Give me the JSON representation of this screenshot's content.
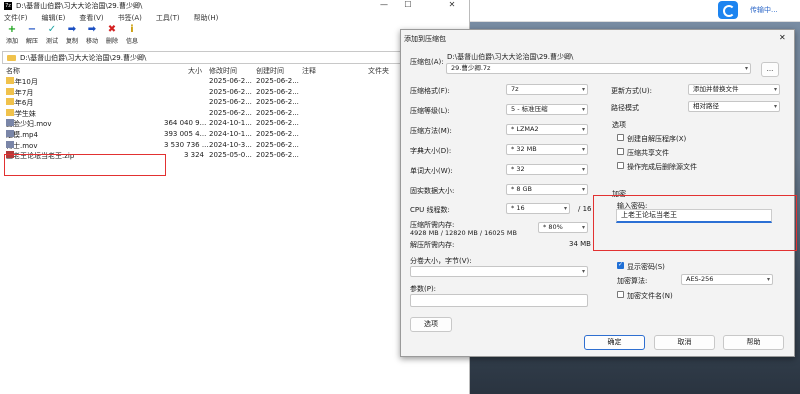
{
  "window": {
    "title": "D:\\基督山伯爵\\习大大论治国\\29.曹少卿\\",
    "icon": "7z"
  },
  "menu": [
    "文件(F)",
    "编辑(E)",
    "查看(V)",
    "书签(A)",
    "工具(T)",
    "帮助(H)"
  ],
  "toolbar": [
    {
      "label": "添加",
      "icon": "plus-icon",
      "color": "#12a012",
      "glyph": "+"
    },
    {
      "label": "解压",
      "icon": "minus-icon",
      "color": "#1b4fc2",
      "glyph": "−"
    },
    {
      "label": "测试",
      "icon": "check-icon",
      "color": "#1fa3a3",
      "glyph": "✓"
    },
    {
      "label": "复制",
      "icon": "copy-arrow-icon",
      "color": "#1b4fc2",
      "glyph": "➡"
    },
    {
      "label": "移动",
      "icon": "move-arrow-icon",
      "color": "#1b4fc2",
      "glyph": "➡"
    },
    {
      "label": "删除",
      "icon": "delete-x-icon",
      "color": "#d42020",
      "glyph": "✖"
    },
    {
      "label": "信息",
      "icon": "info-icon",
      "color": "#c99a00",
      "glyph": "i"
    }
  ],
  "address": "D:\\基督山伯爵\\习大大论治国\\29.曹少卿\\",
  "columns": {
    "name": "名称",
    "size": "大小",
    "modified": "修改时间",
    "created": "创建时间",
    "comment": "注释",
    "folders": "文件夹"
  },
  "files": [
    {
      "name": "24年10月",
      "size": "",
      "modified": "2025-06-2...",
      "created": "2025-06-2...",
      "type": "folder"
    },
    {
      "name": "24年7月",
      "size": "",
      "modified": "2025-06-2...",
      "created": "2025-06-2...",
      "type": "folder"
    },
    {
      "name": "24年6月",
      "size": "",
      "modified": "2025-06-2...",
      "created": "2025-06-2...",
      "type": "folder"
    },
    {
      "name": "03学生妹",
      "size": "",
      "modified": "2025-06-2...",
      "created": "2025-06-2...",
      "type": "folder"
    },
    {
      "name": "露脸少妇.mov",
      "size": "364 040 9...",
      "modified": "2024-10-1...",
      "created": "2025-06-2...",
      "type": "video"
    },
    {
      "name": "足模.mp4",
      "size": "393 005 4...",
      "modified": "2024-10-1...",
      "created": "2025-06-2...",
      "type": "video"
    },
    {
      "name": "博士.mov",
      "size": "3 530 736 ...",
      "modified": "2024-10-3...",
      "created": "2025-06-2...",
      "type": "video"
    },
    {
      "name": "上老王论坛当老王.zip",
      "size": "3 324",
      "modified": "2025-05-0...",
      "created": "2025-06-2...",
      "type": "zip"
    }
  ],
  "taskbar": {
    "label": "传输中..."
  },
  "dialog": {
    "title": "添加到压缩包",
    "archive_label": "压缩包(A):",
    "archive_path": "D:\\基督山伯爵\\习大大论治国\\29.曹少卿\\",
    "archive_name": "29.曹少卿.7z",
    "browse": "...",
    "format_label": "压缩格式(F):",
    "format_value": "7z",
    "level_label": "压缩等级(L):",
    "level_value": "5 - 标准压缩",
    "method_label": "压缩方法(M):",
    "method_value": "* LZMA2",
    "dict_label": "字典大小(D):",
    "dict_value": "* 32 MB",
    "word_label": "单词大小(W):",
    "word_value": "* 32",
    "solid_label": "固实数据大小:",
    "solid_value": "* 8 GB",
    "cpu_label": "CPU 线程数:",
    "cpu_value": "* 16",
    "cpu_total": "/ 16",
    "mem_label": "压缩所需内存:",
    "mem_detail": "4928 MB / 12820 MB / 16025 MB",
    "mem_value": "* 80%",
    "decomp_label": "解压所需内存:",
    "decomp_value": "34 MB",
    "split_label": "分卷大小，字节(V):",
    "params_label": "参数(P):",
    "options_button": "选项",
    "update_label": "更新方式(U):",
    "update_value": "添加并替换文件",
    "path_label": "路径模式",
    "path_value": "相对路径",
    "options_group": "选项",
    "opt_sfx": "创建自解压程序(X)",
    "opt_shared": "压缩共享文件",
    "opt_delete": "操作完成后删除源文件",
    "encrypt_group": "加密",
    "pwd_label": "输入密码:",
    "pwd_value": "上老王论坛当老王",
    "show_pwd": "显示密码(S)",
    "enc_method_label": "加密算法:",
    "enc_method_value": "AES-256",
    "enc_names": "加密文件名(N)",
    "ok": "确定",
    "cancel": "取消",
    "help": "帮助"
  }
}
